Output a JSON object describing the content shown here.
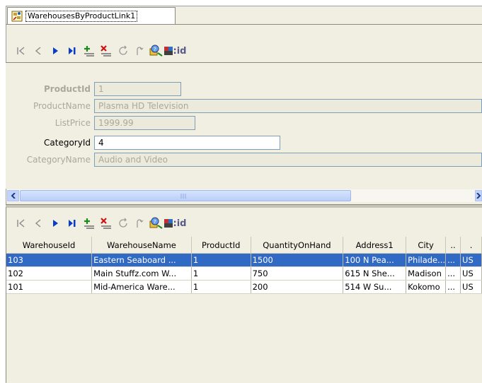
{
  "tab": {
    "label": "WarehousesByProductLink1",
    "icon": "binding-link-icon"
  },
  "toolbar_top": {
    "buttons": [
      "first-icon",
      "previous-icon",
      "next-icon",
      "last-icon",
      "add-icon",
      "delete-icon",
      "refresh-icon",
      "undo-icon",
      "query-id-icon"
    ],
    "id_label": "id"
  },
  "detail": {
    "fields": [
      {
        "label": "ProductId",
        "value": "1"
      },
      {
        "label": "ProductName",
        "value": "Plasma HD Television"
      },
      {
        "label": "ListPrice",
        "value": "1999.99"
      },
      {
        "label": "CategoryId",
        "value": "4"
      },
      {
        "label": "CategoryName",
        "value": "Audio and Video"
      }
    ]
  },
  "toolbar_bottom": {
    "id_label": "id"
  },
  "grid": {
    "columns": [
      "WarehouseId",
      "WarehouseName",
      "ProductId",
      "QuantityOnHand",
      "Address1",
      "City",
      "..",
      "."
    ],
    "rows": [
      [
        "103",
        "Eastern Seaboard ...",
        "1",
        "1500",
        "100 N Pea...",
        "Philade...",
        "...",
        "US"
      ],
      [
        "102",
        "Main Stuffz.com W...",
        "1",
        "750",
        "615 N She...",
        "Madison",
        "...",
        "US"
      ],
      [
        "101",
        "Mid-America Ware...",
        "1",
        "200",
        "514 W Su...",
        "Kokomo",
        "...",
        "US"
      ]
    ],
    "selected_row": 0
  },
  "colors": {
    "selection": "#316ac5",
    "nav_blue": "#0a3cc8",
    "add_green": "#1a8a1a",
    "delete_red": "#d01010"
  }
}
